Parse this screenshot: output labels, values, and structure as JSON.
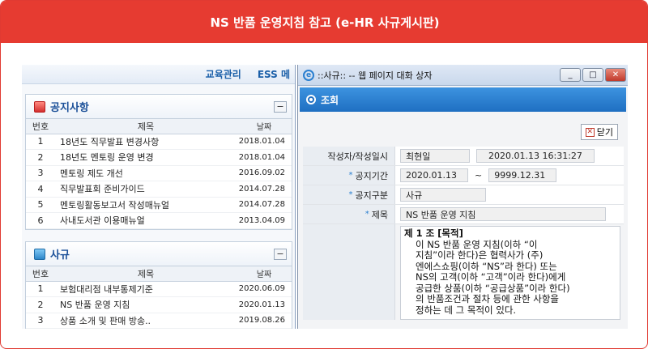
{
  "banner": {
    "title": "NS 반품 운영지침 참고 (e-HR 사규게시판)"
  },
  "portal": {
    "nav": [
      "교육관리",
      "ESS 메"
    ],
    "notice": {
      "title": "공지사항",
      "collapse": "−",
      "headers": {
        "no": "번호",
        "title": "제목",
        "date": "날짜"
      },
      "rows": [
        {
          "no": "1",
          "title": "18년도 직무발표 변경사항",
          "date": "2018.01.04"
        },
        {
          "no": "2",
          "title": "18년도 멘토링 운영 변경",
          "date": "2018.01.04"
        },
        {
          "no": "3",
          "title": "멘토링 제도 개선",
          "date": "2016.09.02"
        },
        {
          "no": "4",
          "title": "직무발표회 준비가이드",
          "date": "2014.07.28"
        },
        {
          "no": "5",
          "title": "멘토링활동보고서 작성매뉴얼",
          "date": "2014.07.28"
        },
        {
          "no": "6",
          "title": "사내도서관 이용매뉴얼",
          "date": "2013.04.09"
        }
      ]
    },
    "rules": {
      "title": "사규",
      "collapse": "−",
      "headers": {
        "no": "번호",
        "title": "제목",
        "date": "날짜"
      },
      "rows": [
        {
          "no": "1",
          "title": "보험대리점 내부통제기준",
          "date": "2020.06.09"
        },
        {
          "no": "2",
          "title": "NS 반품 운영 지침",
          "date": "2020.01.13"
        },
        {
          "no": "3",
          "title": "상품 소개 및 판매 방송..",
          "date": "2019.08.26"
        }
      ]
    }
  },
  "dialog": {
    "title": "::사규:: -- 웹 페이지 대화 상자",
    "win_minimize": "_",
    "win_maximize": "□",
    "win_close": "✕",
    "section": "조회",
    "close_label": "닫기",
    "form": {
      "author_label": "작성자/작성일시",
      "author": "최현일",
      "datetime": "2020.01.13 16:31:27",
      "period_label": "공지기간",
      "period_from": "2020.01.13",
      "period_sep": "~",
      "period_to": "9999.12.31",
      "category_label": "공지구분",
      "category": "사규",
      "subject_label": "제목",
      "subject": "NS 반품 운영 지침",
      "star": "*"
    },
    "content": {
      "clause": "제 1 조 [목적]",
      "lines": [
        "이 NS 반품 운영 지침(이하 “이",
        "지침”이라 한다)은 협력사가 (주)",
        "엔에스쇼핑(이하 “NS”라 한다) 또는",
        "NS의 고객(이하 “고객”이라 한다)에게",
        "공급한 상품(이하 “공급상품”이라 한다)",
        "의 반품조건과 절차 등에 관한 사항을",
        "정하는 데 그 목적이 있다."
      ]
    }
  }
}
